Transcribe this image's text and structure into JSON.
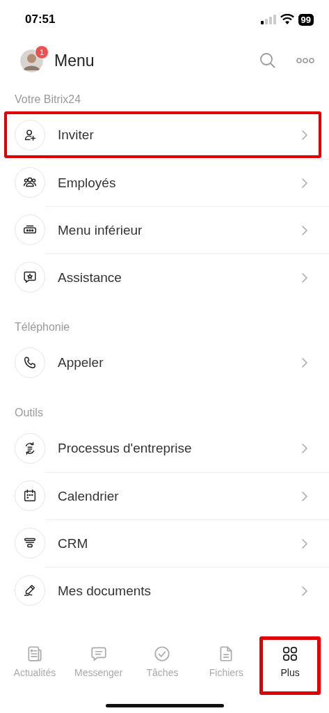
{
  "status_bar": {
    "time": "07:51",
    "battery": "99"
  },
  "header": {
    "title": "Menu",
    "avatar_badge": "1"
  },
  "sections": [
    {
      "title": "Votre Bitrix24",
      "items": [
        {
          "label": "Inviter",
          "kind": "invite",
          "highlighted": true
        },
        {
          "label": "Employés",
          "kind": "people",
          "highlighted": false
        },
        {
          "label": "Menu inférieur",
          "kind": "bar",
          "highlighted": false
        },
        {
          "label": "Assistance",
          "kind": "support",
          "highlighted": false
        }
      ]
    },
    {
      "title": "Téléphonie",
      "items": [
        {
          "label": "Appeler",
          "kind": "phone",
          "highlighted": false
        }
      ]
    },
    {
      "title": "Outils",
      "items": [
        {
          "label": "Processus d'entreprise",
          "kind": "process",
          "highlighted": false
        },
        {
          "label": "Calendrier",
          "kind": "calendar",
          "highlighted": false
        },
        {
          "label": "CRM",
          "kind": "funnel",
          "highlighted": false
        },
        {
          "label": "Mes documents",
          "kind": "pen",
          "highlighted": false
        }
      ]
    }
  ],
  "tabs": [
    {
      "label": "Actualités",
      "kind": "news",
      "selected": false,
      "highlighted": false
    },
    {
      "label": "Messenger",
      "kind": "chat",
      "selected": false,
      "highlighted": false
    },
    {
      "label": "Tâches",
      "kind": "check",
      "selected": false,
      "highlighted": false
    },
    {
      "label": "Fichiers",
      "kind": "file",
      "selected": false,
      "highlighted": false
    },
    {
      "label": "Plus",
      "kind": "grid",
      "selected": true,
      "highlighted": true
    }
  ]
}
